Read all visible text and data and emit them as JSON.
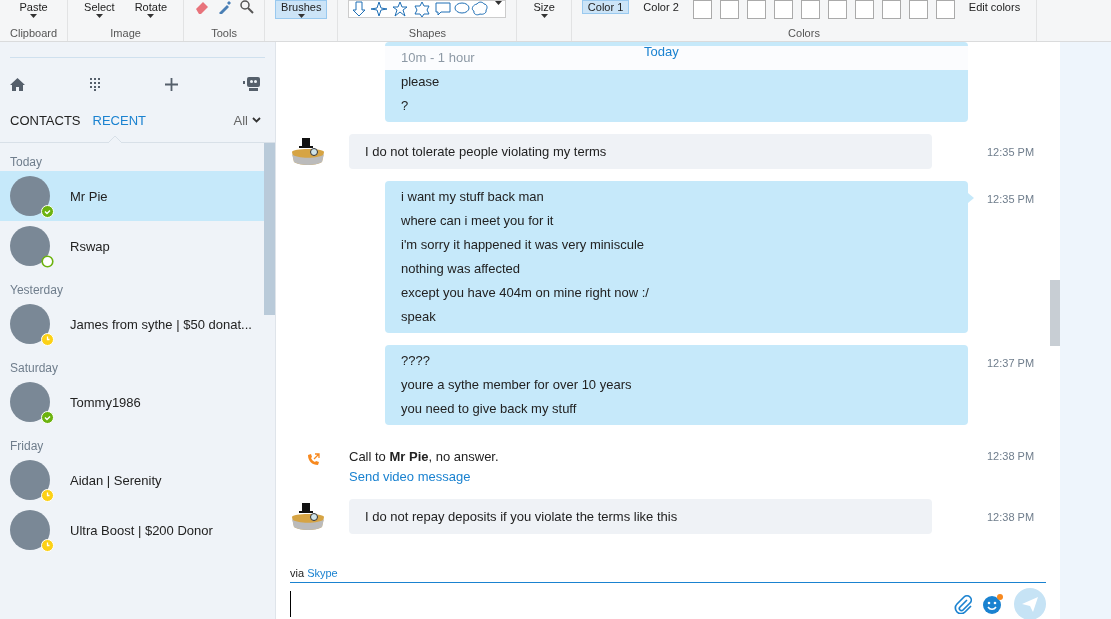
{
  "ribbon": {
    "groups": [
      {
        "kind": "buttons",
        "label": "Clipboard",
        "buttons": [
          {
            "label": "Paste",
            "caret": true,
            "selected": false
          }
        ]
      },
      {
        "kind": "buttons",
        "label": "Image",
        "buttons": [
          {
            "label": "Select",
            "caret": true,
            "selected": false
          },
          {
            "label": "Rotate",
            "caret": true,
            "selected": false
          }
        ]
      },
      {
        "kind": "tools",
        "label": "Tools"
      },
      {
        "kind": "buttons",
        "buttons": [
          {
            "label": "Brushes",
            "caret": true,
            "selected": true
          }
        ]
      },
      {
        "kind": "shapes",
        "label": "Shapes"
      },
      {
        "kind": "buttons",
        "buttons": [
          {
            "label": "Size",
            "caret": true,
            "selected": false
          }
        ]
      },
      {
        "kind": "colors",
        "label": "Colors",
        "buttons": [
          {
            "label": "Color 1",
            "caret": false,
            "selected": true
          },
          {
            "label": "Color 2",
            "caret": false,
            "selected": false
          }
        ],
        "edit": "Edit colors"
      }
    ]
  },
  "sidebar": {
    "tabs": [
      {
        "label": "CONTACTS",
        "selected": false
      },
      {
        "label": "RECENT",
        "selected": true
      }
    ],
    "filter": "All",
    "sections": [
      {
        "title": "Today",
        "contacts": [
          {
            "name": "Mr Pie",
            "kind": "online",
            "selected": true
          },
          {
            "name": "Rswap",
            "kind": "mobile",
            "selected": false
          }
        ]
      },
      {
        "title": "Yesterday",
        "contacts": [
          {
            "name": "James from sythe | $50 donat...",
            "kind": "away",
            "selected": false
          }
        ]
      },
      {
        "title": "Saturday",
        "contacts": [
          {
            "name": "Tommy1986",
            "kind": "online",
            "selected": false
          }
        ]
      },
      {
        "title": "Friday",
        "contacts": [
          {
            "name": "Aidan | Serenity",
            "kind": "away",
            "selected": false
          },
          {
            "name": "Ultra Boost | $200 Donor",
            "kind": "away",
            "selected": false
          }
        ]
      }
    ]
  },
  "chat": {
    "day": "Today",
    "messages": [
      {
        "kind": "outgoing",
        "faded_line": "10m - 1 hour",
        "lines": [
          "please",
          "?"
        ],
        "tail": false
      },
      {
        "kind": "incoming",
        "text": "I do not tolerate people violating my terms",
        "time": "12:35 PM"
      },
      {
        "kind": "outgoing",
        "lines": [
          "i want my stuff back man",
          "where can i meet you for it",
          "i'm sorry it happened it was very miniscule",
          "nothing was affected",
          "except you have 404m on mine right now :/",
          "speak"
        ],
        "time": "12:35 PM",
        "tail": true
      },
      {
        "kind": "outgoing",
        "lines": [
          "????",
          "youre a sythe member for over 10 years",
          "you need to give back my stuff"
        ],
        "time": "12:37 PM",
        "tail": false
      },
      {
        "kind": "call",
        "text": "Call to **Mr Pie**, no answer.",
        "link": "Send video message",
        "time": "12:38 PM"
      },
      {
        "kind": "incoming",
        "text": "I do not repay deposits if you violate the terms like this",
        "time": "12:38 PM"
      }
    ]
  },
  "composer": {
    "via": "via",
    "service": "Skype"
  }
}
